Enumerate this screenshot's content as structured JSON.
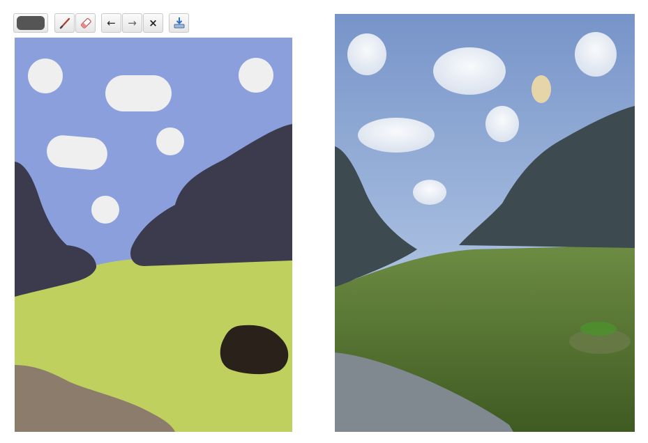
{
  "toolbar": {
    "buttons": [
      {
        "id": "color",
        "icon": "color-swatch-icon",
        "label": ""
      },
      {
        "id": "brush",
        "icon": "brush-icon",
        "label": ""
      },
      {
        "id": "eraser",
        "icon": "eraser-icon",
        "label": ""
      },
      {
        "id": "undo",
        "icon": "undo-arrow-icon",
        "label": "←"
      },
      {
        "id": "redo",
        "icon": "redo-arrow-icon",
        "label": "→"
      },
      {
        "id": "clear",
        "icon": "clear-x-icon",
        "label": "×"
      },
      {
        "id": "download",
        "icon": "download-icon",
        "label": ""
      }
    ],
    "current_color": "#555555"
  },
  "canvas": {
    "colors": {
      "sky": "#8a9fdc",
      "cloud": "#efefef",
      "mountain": "#3c3b4d",
      "grass": "#bfd05f",
      "path": "#8c7c6b",
      "rock": "#2a211b"
    }
  },
  "output": {
    "colors": {
      "sky_top": "#7794c9",
      "sky_bottom": "#c9dbef",
      "mountain": "#3d4a4f",
      "grass": "#5a7a36",
      "path": "#808890"
    }
  }
}
